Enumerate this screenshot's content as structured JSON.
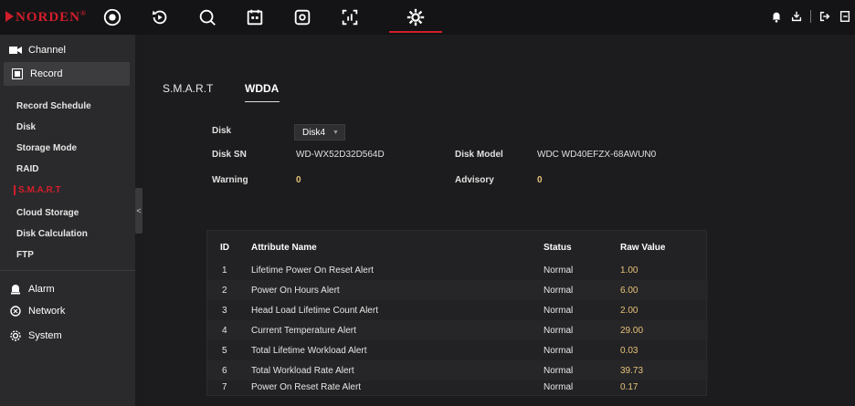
{
  "brand": {
    "name": "NORDEN",
    "mark": "®"
  },
  "topnav": [
    {
      "icon": "live-view-icon"
    },
    {
      "icon": "playback-icon"
    },
    {
      "icon": "search-icon"
    },
    {
      "icon": "calendar-icon"
    },
    {
      "icon": "storage-icon"
    },
    {
      "icon": "analytics-icon"
    },
    {
      "icon": "settings-icon"
    }
  ],
  "top_right": [
    "bell-icon",
    "download-icon",
    "logout-icon",
    "exit-icon"
  ],
  "sidebar": {
    "channel": "Channel",
    "record": "Record",
    "sub": [
      "Record Schedule",
      "Disk",
      "Storage Mode",
      "RAID",
      "S.M.A.R.T",
      "Cloud Storage",
      "Disk Calculation",
      "FTP"
    ],
    "alarm": "Alarm",
    "network": "Network",
    "system": "System",
    "collapse": "<"
  },
  "tabs": [
    "S.M.A.R.T",
    "WDDA"
  ],
  "disk": {
    "label": "Disk",
    "value": "Disk4",
    "sn_label": "Disk SN",
    "sn": "WD-WX52D32D564D",
    "model_label": "Disk Model",
    "model": "WDC WD40EFZX-68AWUN0",
    "warning_label": "Warning",
    "warning": "0",
    "advisory_label": "Advisory",
    "advisory": "0"
  },
  "table": {
    "headers": [
      "ID",
      "Attribute Name",
      "Status",
      "Raw Value"
    ],
    "rows": [
      [
        "1",
        "Lifetime Power On Reset Alert",
        "Normal",
        "1.00"
      ],
      [
        "2",
        "Power On Hours Alert",
        "Normal",
        "6.00"
      ],
      [
        "3",
        "Head Load Lifetime Count Alert",
        "Normal",
        "2.00"
      ],
      [
        "4",
        "Current Temperature Alert",
        "Normal",
        "29.00"
      ],
      [
        "5",
        "Total Lifetime Workload Alert",
        "Normal",
        "0.03"
      ],
      [
        "6",
        "Total Workload Rate Alert",
        "Normal",
        "39.73"
      ],
      [
        "7",
        "Power On Reset Rate Alert",
        "Normal",
        "0.17"
      ]
    ]
  },
  "colors": {
    "accent": "#d21e2b",
    "value": "#e8c27a"
  }
}
